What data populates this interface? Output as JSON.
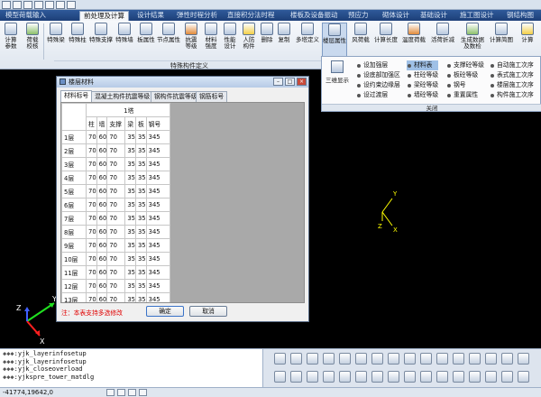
{
  "menu_tabs": [
    "模型荷载输入",
    "前处理及计算",
    "设计结果",
    "弹性时程分析",
    "直接积分法时程",
    "楼板及设备振动",
    "预应力",
    "砌体设计",
    "基础设计",
    "施工图设计",
    "钢结构图"
  ],
  "ribbon": {
    "buttons": [
      "计算\n参数",
      "荷载\n校核",
      "特殊梁",
      "特殊柱",
      "特殊支撑",
      "特殊墙",
      "板属性",
      "节点属性",
      "抗震\n等级",
      "材料\n强度",
      "性能\n设计",
      "人防\n构件",
      "删除",
      "复制",
      "多塔定义",
      "楼层属性",
      "风荷载",
      "计算长度",
      "温度荷载",
      "活荷折减",
      "生成数据\n及数检",
      "计算简图",
      "计算"
    ],
    "section_label": "特殊构件定义"
  },
  "panel": {
    "left_label": "三维显示",
    "col1": [
      "设加强层",
      "设底部加强区",
      "设约束边缘层",
      "设过渡层"
    ],
    "col2": [
      "材料表",
      "柱砼等级",
      "梁砼等级",
      "墙砼等级"
    ],
    "col3": [
      "支撑砼等级",
      "板砼等级",
      "钢号",
      "重置属性"
    ],
    "col4": [
      "自动施工次序",
      "表式施工次序",
      "楼层施工次序",
      "构件施工次序"
    ],
    "close_label": "关闭"
  },
  "dialog": {
    "title": "楼层材料",
    "tabs": [
      "材料标号",
      "混凝土构件抗震等级",
      "钢构件抗震等级",
      "钢筋标号"
    ],
    "group_header": "1塔",
    "columns": [
      "柱",
      "墙",
      "支撑",
      "梁",
      "板",
      "钢号"
    ],
    "rows": [
      {
        "floor": "1层",
        "v": [
          "70",
          "60",
          "70",
          "35",
          "35",
          "345"
        ]
      },
      {
        "floor": "2层",
        "v": [
          "70",
          "60",
          "70",
          "35",
          "35",
          "345"
        ]
      },
      {
        "floor": "3层",
        "v": [
          "70",
          "60",
          "70",
          "35",
          "35",
          "345"
        ]
      },
      {
        "floor": "4层",
        "v": [
          "70",
          "60",
          "70",
          "35",
          "35",
          "345"
        ]
      },
      {
        "floor": "5层",
        "v": [
          "70",
          "60",
          "70",
          "35",
          "35",
          "345"
        ]
      },
      {
        "floor": "6层",
        "v": [
          "70",
          "60",
          "70",
          "35",
          "35",
          "345"
        ]
      },
      {
        "floor": "7层",
        "v": [
          "70",
          "60",
          "70",
          "35",
          "35",
          "345"
        ]
      },
      {
        "floor": "8层",
        "v": [
          "70",
          "60",
          "70",
          "35",
          "35",
          "345"
        ]
      },
      {
        "floor": "9层",
        "v": [
          "70",
          "60",
          "70",
          "35",
          "35",
          "345"
        ]
      },
      {
        "floor": "10层",
        "v": [
          "70",
          "60",
          "70",
          "35",
          "35",
          "345"
        ]
      },
      {
        "floor": "11层",
        "v": [
          "70",
          "60",
          "70",
          "35",
          "35",
          "345"
        ]
      },
      {
        "floor": "12层",
        "v": [
          "70",
          "60",
          "70",
          "35",
          "35",
          "345"
        ]
      },
      {
        "floor": "13层",
        "v": [
          "70",
          "60",
          "70",
          "35",
          "35",
          "345"
        ]
      }
    ],
    "note": "注：本表支持多选修改",
    "ok_label": "确定",
    "cancel_label": "取消"
  },
  "axes": {
    "x": "X",
    "y": "Y",
    "z": "Z"
  },
  "command_log": [
    ":yjk_layerinfosetup",
    ":yjk_layerinfosetup",
    ":yjk_closeoverload",
    ":yjkspre_tower_matdlg"
  ],
  "status": {
    "coords": "-41774,19642,0"
  },
  "colors": {
    "accent": "#2f5a9a",
    "axis_x": "#ff2020",
    "axis_y": "#20e020",
    "axis_z": "#4060ff",
    "cursor_axis": "#ffff00",
    "note": "#e00000"
  }
}
